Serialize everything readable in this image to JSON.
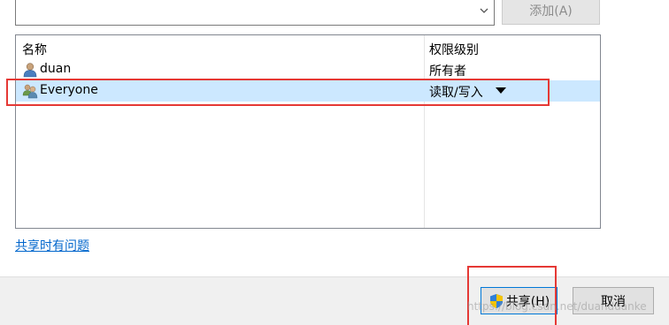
{
  "combo": {
    "value": ""
  },
  "add_button": {
    "label": "添加(A)"
  },
  "list": {
    "headers": {
      "name": "名称",
      "permission": "权限级别"
    },
    "rows": [
      {
        "name": "duan",
        "permission": "所有者",
        "icon": "user-icon",
        "selected": false
      },
      {
        "name": "Everyone",
        "permission": "读取/写入",
        "icon": "group-users-icon",
        "selected": true
      }
    ]
  },
  "help_link": {
    "label": "共享时有问题"
  },
  "footer": {
    "share_label": "共享(H)",
    "cancel_label": "取消"
  },
  "watermark": "https://blog.csdn.net/duanduanke",
  "colors": {
    "highlight_box": "#e53935",
    "selection": "#cce8ff",
    "link": "#0066cc"
  }
}
